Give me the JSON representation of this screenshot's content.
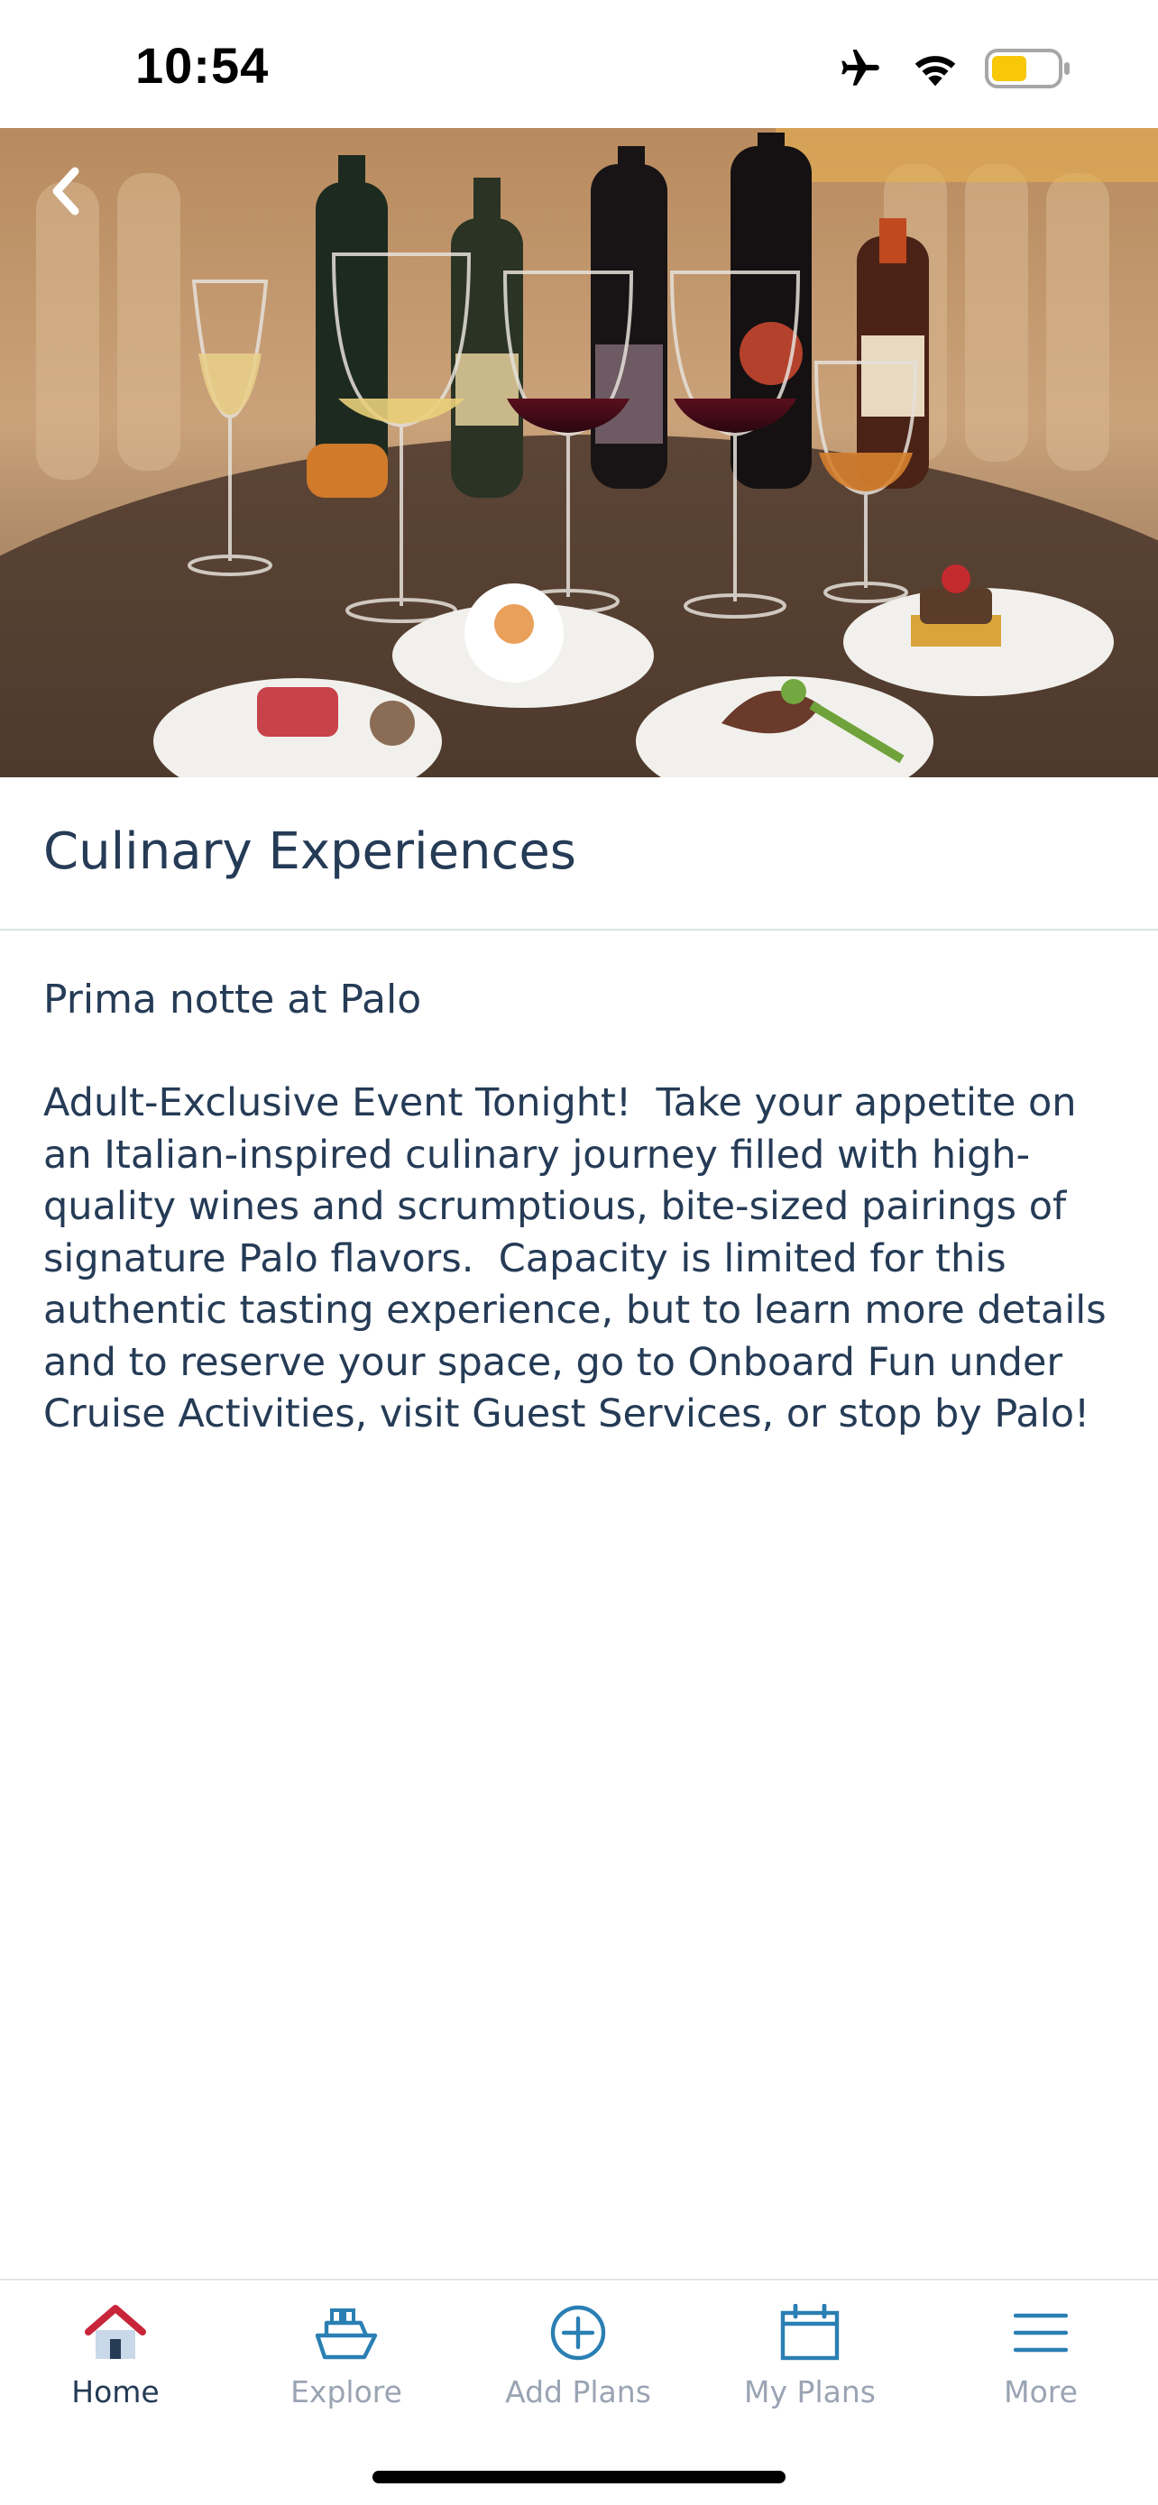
{
  "status_bar": {
    "time": "10:54",
    "icons": [
      "airplane-mode-icon",
      "wifi-icon",
      "battery-icon"
    ],
    "battery_color": "#f7c708"
  },
  "hero": {
    "icon": "back-chevron-icon"
  },
  "page": {
    "title": "Culinary Experiences",
    "subtitle": "Prima notte at Palo",
    "description": "Adult-Exclusive Event Tonight!  Take your appetite on an Italian-inspired culinary journey filled with high-quality wines and scrumptious, bite-sized pairings of signature Palo flavors.  Capacity is limited for this authentic tasting experience, but to learn more details and to reserve your space, go to Onboard Fun under Cruise Activities, visit Guest Services, or stop by Palo!"
  },
  "tab_bar": {
    "tabs": [
      {
        "label": "Home",
        "icon": "home-icon",
        "active": true
      },
      {
        "label": "Explore",
        "icon": "ship-icon",
        "active": false
      },
      {
        "label": "Add Plans",
        "icon": "add-circle-icon",
        "active": false
      },
      {
        "label": "My Plans",
        "icon": "calendar-icon",
        "active": false
      },
      {
        "label": "More",
        "icon": "menu-icon",
        "active": false
      }
    ]
  },
  "colors": {
    "text_primary": "#253b56",
    "tab_inactive": "#9aa4b3",
    "tab_icon_inactive": "#2a7fb3",
    "home_roof": "#c8253a"
  }
}
